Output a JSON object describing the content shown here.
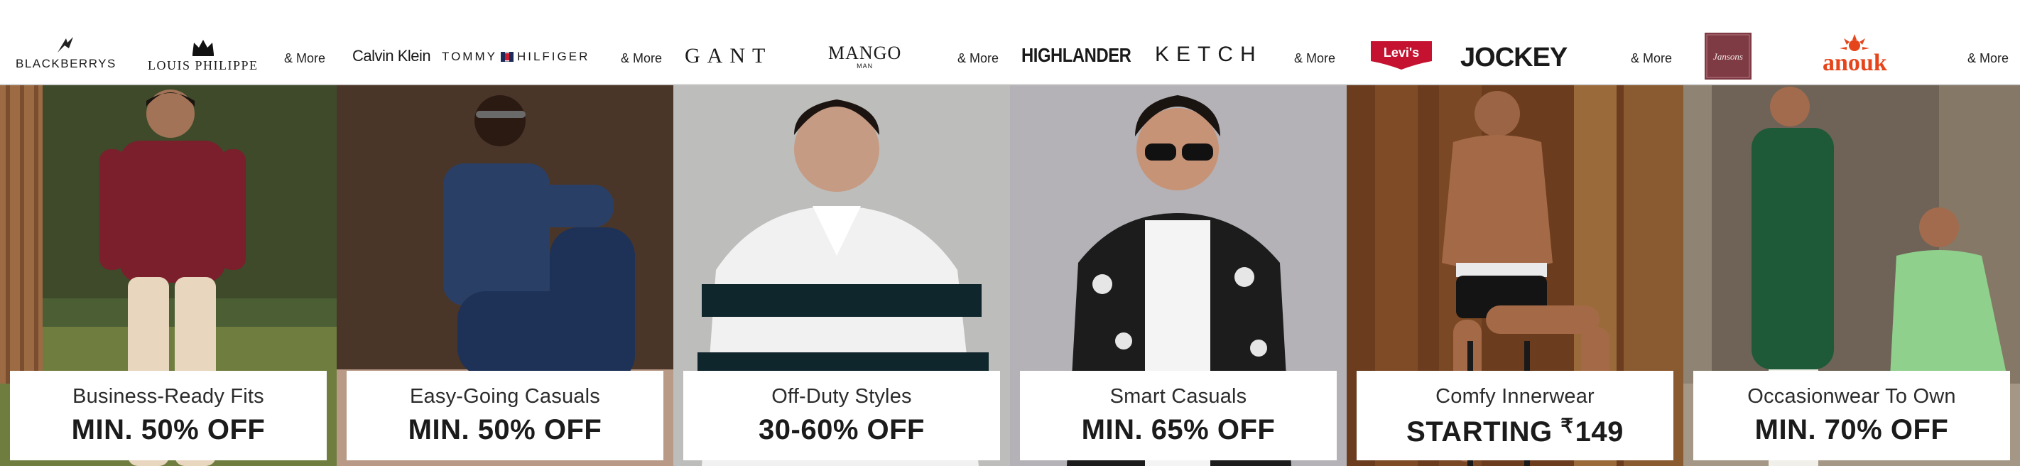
{
  "cards": [
    {
      "brands": [
        "BLACKBERRYS",
        "LOUIS PHILIPPE"
      ],
      "more_label": "& More",
      "category": "Business-Ready Fits",
      "offer": "MIN. 50% OFF",
      "colors": {
        "bg": "#5a6b3a",
        "shirt": "#7a1f2b",
        "pants": "#e8d6bf"
      }
    },
    {
      "brands": [
        "Calvin Klein",
        "TOMMY",
        "HILFIGER"
      ],
      "more_label": "& More",
      "category": "Easy-Going Casuals",
      "offer": "MIN. 50% OFF",
      "colors": {
        "bg": "#5e4536",
        "shirt": "#2a3f66",
        "pants": "#1e3156"
      }
    },
    {
      "brands": [
        "GANT",
        "MANGO",
        "MAN"
      ],
      "more_label": "& More",
      "category": "Off-Duty Styles",
      "offer": "30-60% OFF",
      "colors": {
        "bg": "#bdbdbb",
        "stripe_dark": "#10262d",
        "stripe_light": "#f1f1f1"
      }
    },
    {
      "brands": [
        "HIGHLANDER",
        "KETCH"
      ],
      "more_label": "& More",
      "category": "Smart Casuals",
      "offer": "MIN. 65% OFF",
      "colors": {
        "bg": "#b4b2b7",
        "shirt": "#1c1c1c"
      }
    },
    {
      "brands": [
        "Levi's",
        "JOCKEY"
      ],
      "more_label": "& More",
      "category": "Comfy Innerwear",
      "offer_prefix": "STARTING",
      "offer_currency": "₹",
      "offer_amount": "149",
      "colors": {
        "bg": "#6b3d1e",
        "levis_red": "#c41230"
      }
    },
    {
      "brands": [
        "Jansons",
        "anouk"
      ],
      "more_label": "& More",
      "category": "Occasionwear To Own",
      "offer": "MIN. 70% OFF",
      "colors": {
        "bg": "#6e6356",
        "kurta1": "#1e5a37",
        "kurta2": "#8fd08c",
        "anouk": "#e6451c"
      }
    }
  ]
}
